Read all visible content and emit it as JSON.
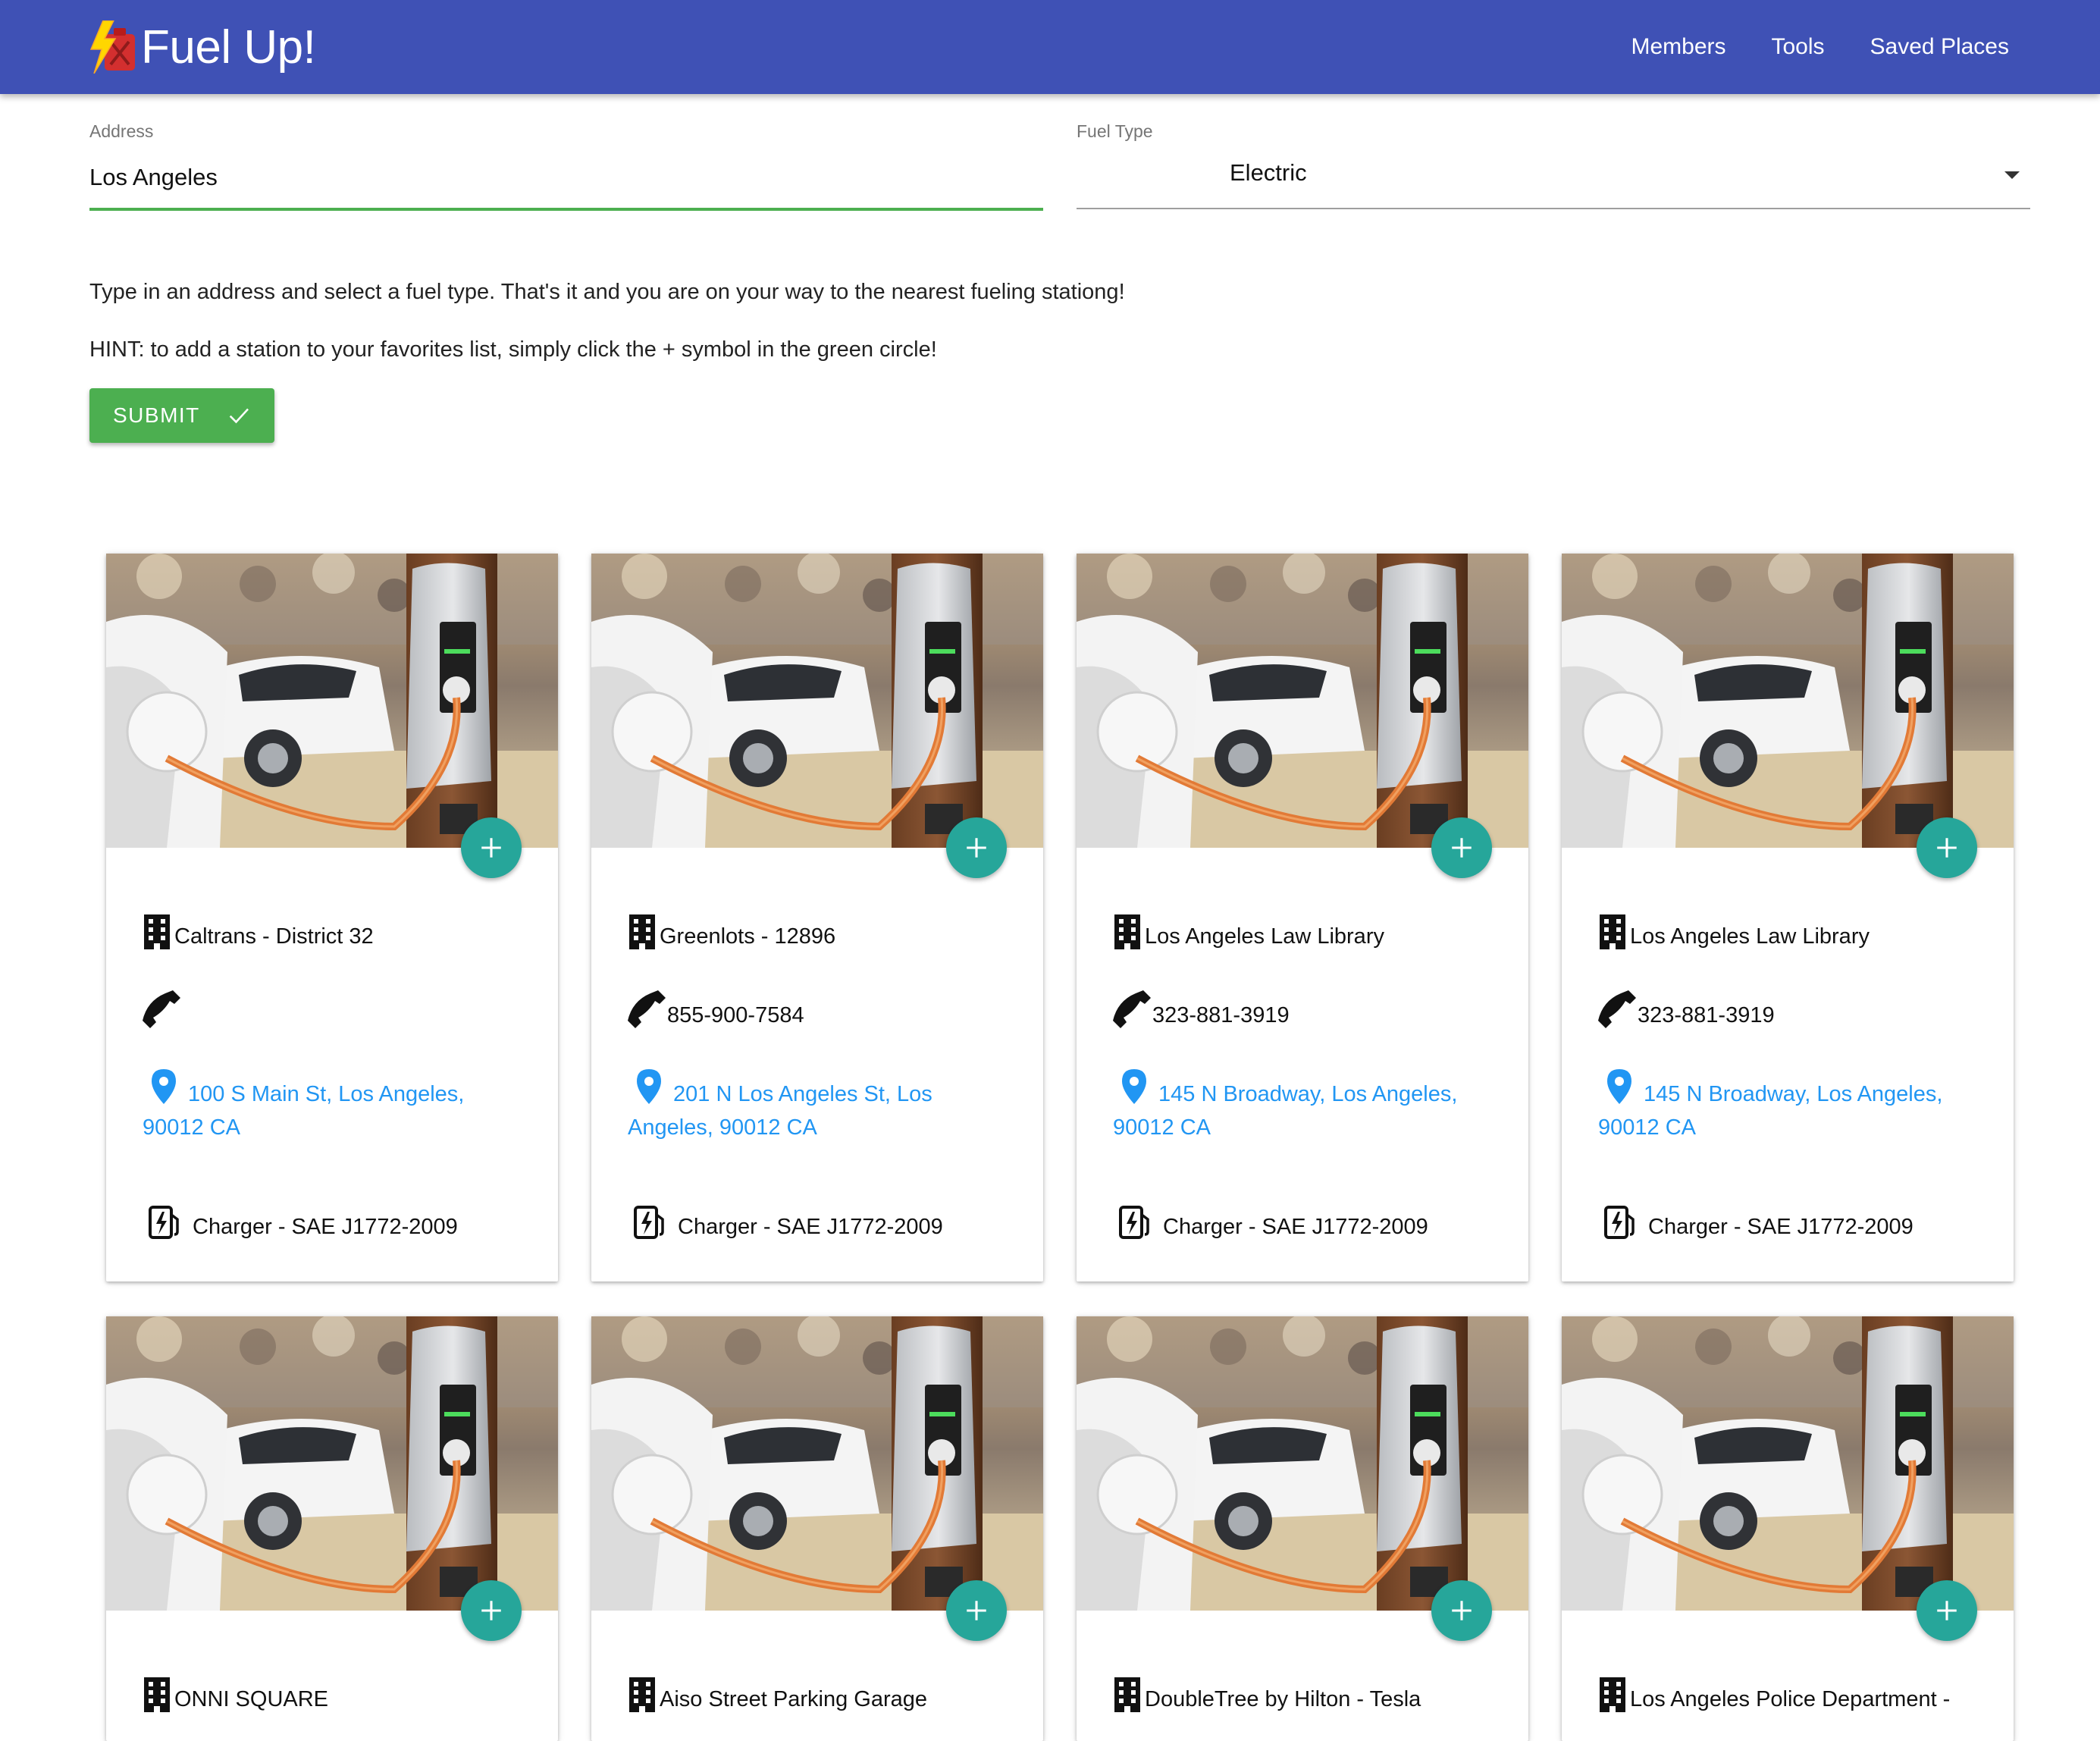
{
  "app": {
    "name": "Fuel Up!",
    "nav": [
      "Members",
      "Tools",
      "Saved Places"
    ]
  },
  "form": {
    "address_label": "Address",
    "address_value": "Los Angeles",
    "fuel_label": "Fuel Type",
    "fuel_value": "Electric",
    "instructions": "Type in an address and select a fuel type. That's it and you are on your way to the nearest fueling stationg!",
    "hint": "HINT: to add a station to your favorites list, simply click the + symbol in the green circle!",
    "submit_label": "SUBMIT"
  },
  "colors": {
    "appbar": "#3f51b5",
    "accent_green": "#4caf50",
    "fab_teal": "#26a69a",
    "link_blue": "#2196f3"
  },
  "icons": {
    "logo": "fuel-can-lightning-icon",
    "name": "building-icon",
    "phone": "phone-icon",
    "address": "map-pin-icon",
    "charger": "ev-charger-icon",
    "add": "plus-icon",
    "submit": "check-icon"
  },
  "stations": [
    {
      "name": "Caltrans - District 32",
      "phone": "",
      "address": "100 S Main St, Los Angeles, 90012 CA",
      "charger": "Charger - SAE J1772-2009"
    },
    {
      "name": "Greenlots - 12896",
      "phone": "855-900-7584",
      "address": "201 N Los Angeles St, Los Angeles, 90012 CA",
      "charger": "Charger - SAE J1772-2009"
    },
    {
      "name": "Los Angeles Law Library",
      "phone": "323-881-3919",
      "address": "145 N Broadway, Los Angeles, 90012 CA",
      "charger": "Charger - SAE J1772-2009"
    },
    {
      "name": "Los Angeles Law Library",
      "phone": "323-881-3919",
      "address": "145 N Broadway, Los Angeles, 90012 CA",
      "charger": "Charger - SAE J1772-2009"
    },
    {
      "name": "ONNI SQUARE"
    },
    {
      "name": "Aiso Street Parking Garage"
    },
    {
      "name": "DoubleTree by Hilton - Tesla"
    },
    {
      "name": "Los Angeles Police Department -"
    }
  ]
}
